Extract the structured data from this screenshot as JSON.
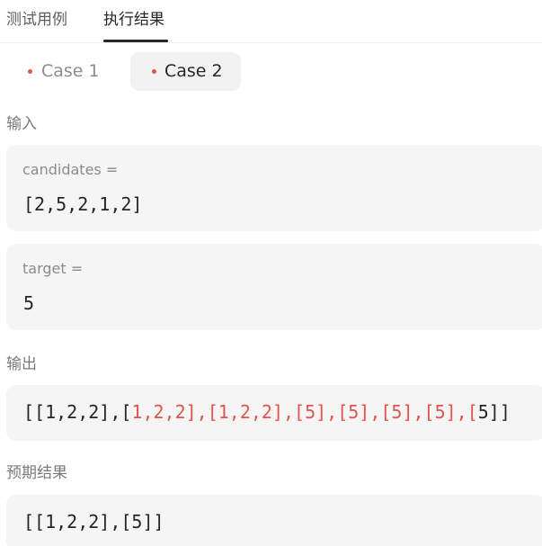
{
  "tabs": [
    {
      "label": "测试用例",
      "active": false
    },
    {
      "label": "执行结果",
      "active": true
    }
  ],
  "cases": [
    {
      "label": "Case 1",
      "active": false
    },
    {
      "label": "Case 2",
      "active": true
    }
  ],
  "colors": {
    "dot": "#e0554c",
    "diff_text": "#e0554c",
    "box_bg": "#f5f5f5",
    "active_case_bg": "#f2f2f2"
  },
  "input": {
    "label": "输入",
    "params": [
      {
        "name": "candidates =",
        "value": "[2,5,2,1,2]"
      },
      {
        "name": "target =",
        "value": "5"
      }
    ]
  },
  "output": {
    "label": "输出",
    "prefix": "[[1,2,2],[",
    "diff": "1,2,2],[1,2,2],[5],[5],[5],[5],[",
    "suffix": "5]]"
  },
  "expected": {
    "label": "预期结果",
    "value": "[[1,2,2],[5]]"
  }
}
